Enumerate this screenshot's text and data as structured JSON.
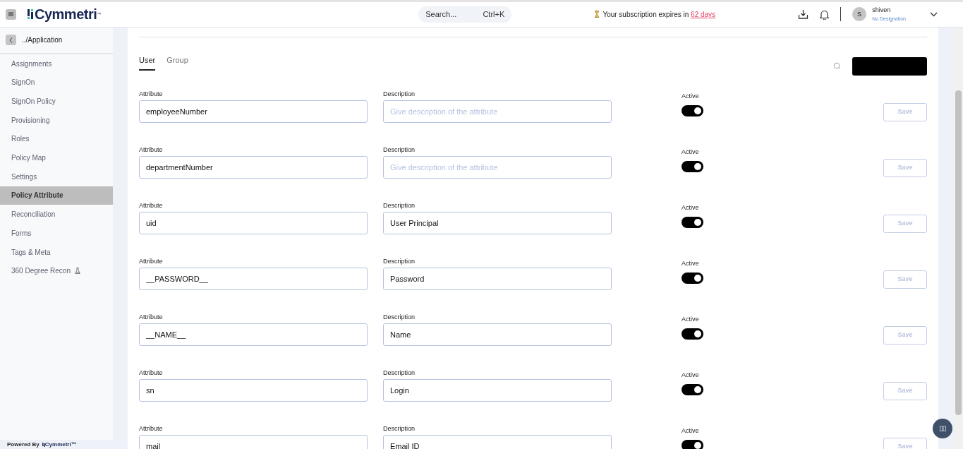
{
  "header": {
    "logo_text": "Cymmetri",
    "logo_mark": "™",
    "search": {
      "placeholder": "Search...",
      "shortcut": "Ctrl+K"
    },
    "subscription": {
      "text": "Your subscription expires in",
      "link": "62 days"
    },
    "user": {
      "avatar": "S",
      "name": "shiven",
      "designation": "No Designation"
    }
  },
  "sidebar": {
    "back_label": "../Application",
    "items": [
      {
        "label": "Assignments",
        "selected": false
      },
      {
        "label": "SignOn",
        "selected": false
      },
      {
        "label": "SignOn Policy",
        "selected": false
      },
      {
        "label": "Provisioning",
        "selected": false
      },
      {
        "label": "Roles",
        "selected": false
      },
      {
        "label": "Policy Map",
        "selected": false
      },
      {
        "label": "Settings",
        "selected": false
      },
      {
        "label": "Policy Attribute",
        "selected": true
      },
      {
        "label": "Reconciliation",
        "selected": false
      },
      {
        "label": "Forms",
        "selected": false
      },
      {
        "label": "Tags & Meta",
        "selected": false
      },
      {
        "label": "360 Degree Recon",
        "selected": false,
        "beta": true
      }
    ],
    "footer": {
      "powered_by": "Powered By",
      "brand": "Cymmetri",
      "mark": "™"
    }
  },
  "tabs": [
    {
      "label": "User",
      "selected": true
    },
    {
      "label": "Group",
      "selected": false
    }
  ],
  "attributes": [
    {
      "attribute_label": "Attribute",
      "attribute": "employeeNumber",
      "description_label": "Description",
      "description_placeholder": "Give description of the attribute",
      "active_label": "Active",
      "active": true,
      "save": "Save"
    },
    {
      "attribute_label": "Attribute",
      "attribute": "departmentNumber",
      "description_label": "Description",
      "description_placeholder": "Give description of the attribute",
      "active_label": "Active",
      "active": true,
      "save": "Save"
    },
    {
      "attribute_label": "Attribute",
      "attribute": "uid",
      "description_label": "Description",
      "description": "User Principal",
      "active_label": "Active",
      "active": true,
      "save": "Save"
    },
    {
      "attribute_label": "Attribute",
      "attribute": "__PASSWORD__",
      "description_label": "Description",
      "description": "Password",
      "active_label": "Active",
      "active": true,
      "save": "Save"
    },
    {
      "attribute_label": "Attribute",
      "attribute": "__NAME__",
      "description_label": "Description",
      "description": "Name",
      "active_label": "Active",
      "active": true,
      "save": "Save"
    },
    {
      "attribute_label": "Attribute",
      "attribute": "sn",
      "description_label": "Description",
      "description": "Login",
      "active_label": "Active",
      "active": true,
      "save": "Save"
    },
    {
      "attribute_label": "Attribute",
      "attribute": "mail",
      "description_label": "Description",
      "description": "Email ID",
      "active_label": "Active",
      "active": true,
      "save": "Save"
    }
  ]
}
